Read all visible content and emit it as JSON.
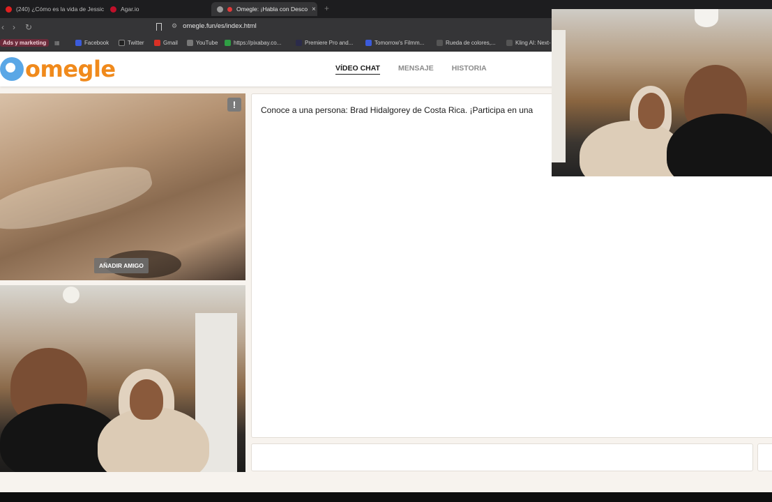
{
  "browser": {
    "tabs": [
      {
        "label": "(240) ¿Cómo es la vida de Jessic",
        "color": "#e02020"
      },
      {
        "label": "Agar.io",
        "color": "#c0102a"
      },
      {
        "label": "Omegle: ¡Habla con Desco",
        "color": "#9a9a9a",
        "active": true
      }
    ],
    "new_tab": "+",
    "url": "omegle.fun/es/index.html",
    "bookmarks": [
      {
        "label": "Ads y marketing",
        "chip": true
      },
      {
        "label": "Facebook",
        "color": "#3b5bdb"
      },
      {
        "label": "Twitter",
        "color": "#222222"
      },
      {
        "label": "Gmail",
        "color": "#d93025"
      },
      {
        "label": "YouTube",
        "color": "#777777"
      },
      {
        "label": "https://pixabay.co...",
        "color": "#2f9e44"
      },
      {
        "label": "Premiere Pro and...",
        "color": "#2b2b4a"
      },
      {
        "label": "Tomorrow's Filmm...",
        "color": "#3b5bdb"
      },
      {
        "label": "Rueda de colores,...",
        "color": "#555555"
      },
      {
        "label": "Kling AI: Next-",
        "color": "#555555"
      }
    ]
  },
  "site": {
    "logo_text": "omegle",
    "nav": [
      {
        "label": "VÍDEO CHAT",
        "active": true
      },
      {
        "label": "MENSAJE"
      },
      {
        "label": "HISTORIA"
      }
    ]
  },
  "stranger_video": {
    "report_label": "!",
    "add_friend_label": "AÑADIR AMIGO"
  },
  "chat": {
    "message": "Conoce a una persona: Brad Hidalgorey de Costa Rica. ¡Participa en una"
  },
  "colors": {
    "logo_orange": "#f08a1c",
    "logo_blue": "#5aa7e6"
  }
}
